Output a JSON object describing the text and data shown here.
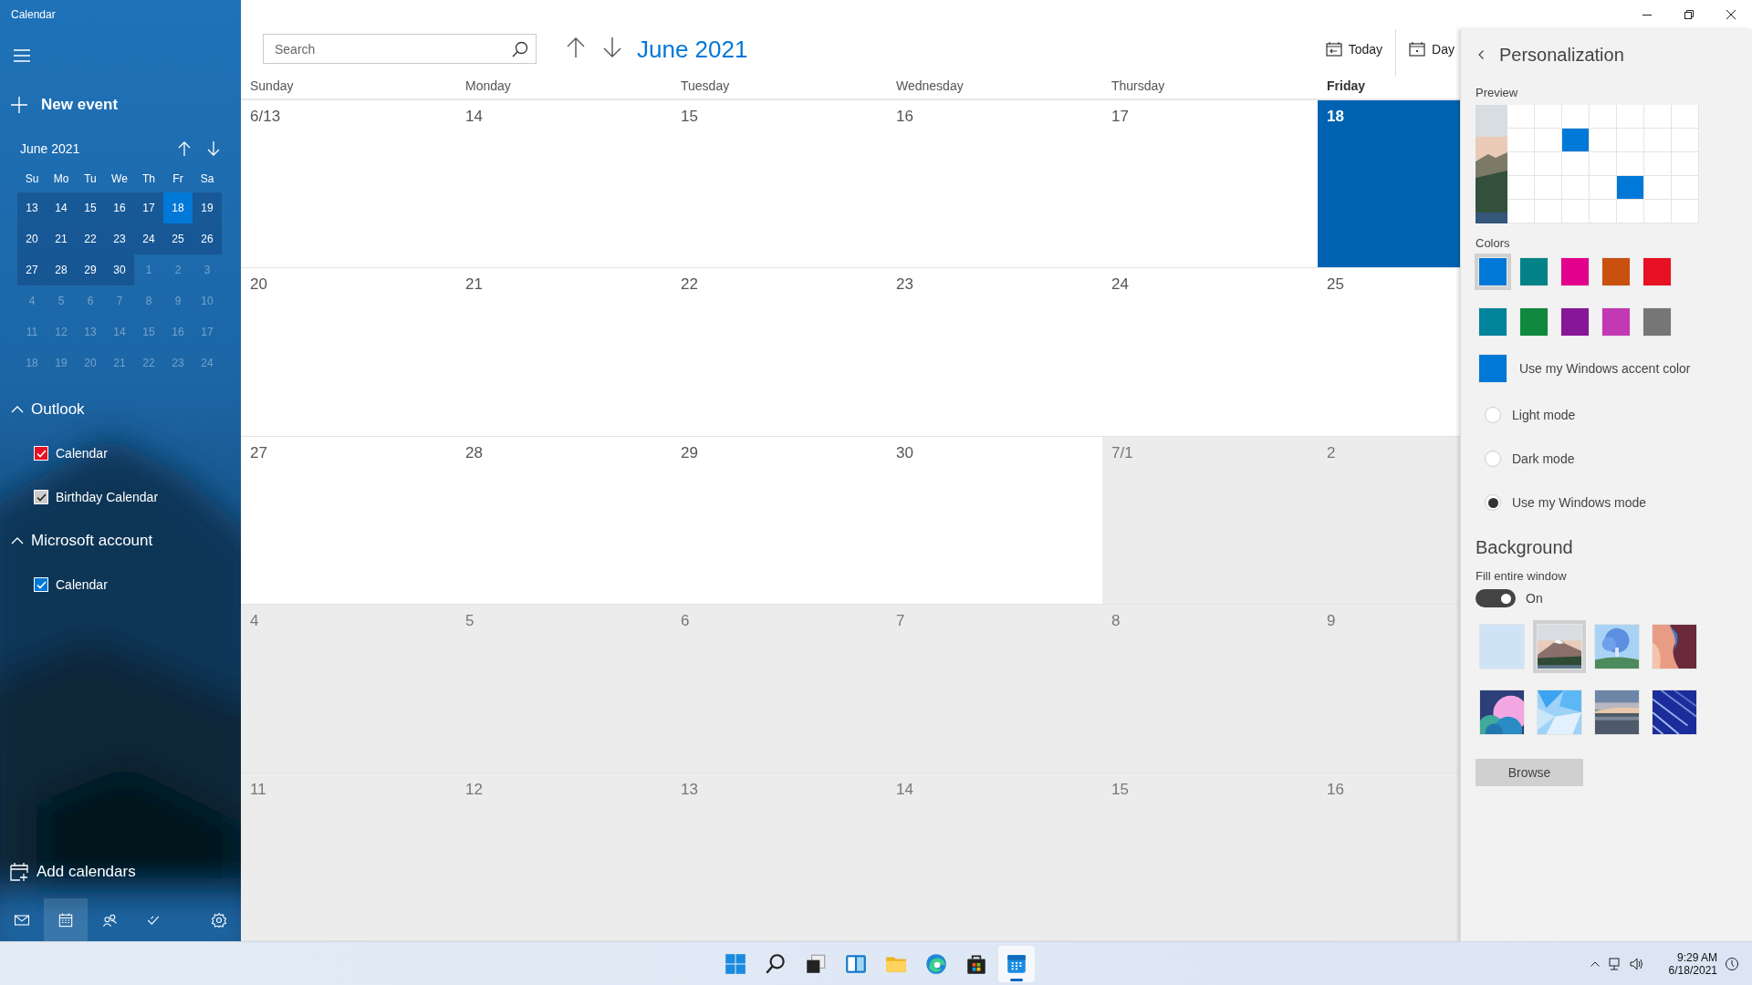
{
  "app_title": "Calendar",
  "sidebar": {
    "new_event": "New event",
    "mini_calendar": {
      "title": "June 2021",
      "weekdays": [
        "Su",
        "Mo",
        "Tu",
        "We",
        "Th",
        "Fr",
        "Sa"
      ],
      "weeks": [
        [
          {
            "day": "13",
            "in_view": true,
            "selected": false
          },
          {
            "day": "14",
            "in_view": true,
            "selected": false
          },
          {
            "day": "15",
            "in_view": true,
            "selected": false
          },
          {
            "day": "16",
            "in_view": true,
            "selected": false
          },
          {
            "day": "17",
            "in_view": true,
            "selected": false
          },
          {
            "day": "18",
            "in_view": true,
            "selected": true
          },
          {
            "day": "19",
            "in_view": true,
            "selected": false
          }
        ],
        [
          {
            "day": "20",
            "in_view": true,
            "selected": false
          },
          {
            "day": "21",
            "in_view": true,
            "selected": false
          },
          {
            "day": "22",
            "in_view": true,
            "selected": false
          },
          {
            "day": "23",
            "in_view": true,
            "selected": false
          },
          {
            "day": "24",
            "in_view": true,
            "selected": false
          },
          {
            "day": "25",
            "in_view": true,
            "selected": false
          },
          {
            "day": "26",
            "in_view": true,
            "selected": false
          }
        ],
        [
          {
            "day": "27",
            "in_view": true,
            "selected": false
          },
          {
            "day": "28",
            "in_view": true,
            "selected": false
          },
          {
            "day": "29",
            "in_view": true,
            "selected": false
          },
          {
            "day": "30",
            "in_view": true,
            "selected": false
          },
          {
            "day": "1",
            "in_view": false,
            "selected": false
          },
          {
            "day": "2",
            "in_view": false,
            "selected": false
          },
          {
            "day": "3",
            "in_view": false,
            "selected": false
          }
        ],
        [
          {
            "day": "4",
            "in_view": false,
            "selected": false
          },
          {
            "day": "5",
            "in_view": false,
            "selected": false
          },
          {
            "day": "6",
            "in_view": false,
            "selected": false
          },
          {
            "day": "7",
            "in_view": false,
            "selected": false
          },
          {
            "day": "8",
            "in_view": false,
            "selected": false
          },
          {
            "day": "9",
            "in_view": false,
            "selected": false
          },
          {
            "day": "10",
            "in_view": false,
            "selected": false
          }
        ],
        [
          {
            "day": "11",
            "in_view": false,
            "selected": false
          },
          {
            "day": "12",
            "in_view": false,
            "selected": false
          },
          {
            "day": "13",
            "in_view": false,
            "selected": false
          },
          {
            "day": "14",
            "in_view": false,
            "selected": false
          },
          {
            "day": "15",
            "in_view": false,
            "selected": false
          },
          {
            "day": "16",
            "in_view": false,
            "selected": false
          },
          {
            "day": "17",
            "in_view": false,
            "selected": false
          }
        ],
        [
          {
            "day": "18",
            "in_view": false,
            "selected": false
          },
          {
            "day": "19",
            "in_view": false,
            "selected": false
          },
          {
            "day": "20",
            "in_view": false,
            "selected": false
          },
          {
            "day": "21",
            "in_view": false,
            "selected": false
          },
          {
            "day": "22",
            "in_view": false,
            "selected": false
          },
          {
            "day": "23",
            "in_view": false,
            "selected": false
          },
          {
            "day": "24",
            "in_view": false,
            "selected": false
          }
        ]
      ]
    },
    "accounts": [
      {
        "name": "Outlook",
        "expanded": true,
        "calendars": [
          {
            "name": "Calendar",
            "checked": true,
            "color": "#e81123"
          },
          {
            "name": "Birthday Calendar",
            "checked": true,
            "color": "#cccccc"
          }
        ]
      },
      {
        "name": "Microsoft account",
        "expanded": true,
        "calendars": [
          {
            "name": "Calendar",
            "checked": true,
            "color": "#0078d7"
          }
        ]
      }
    ],
    "add_calendars": "Add calendars",
    "nav": [
      {
        "kind": "mail",
        "selected": false
      },
      {
        "kind": "calendar",
        "selected": true
      },
      {
        "kind": "people",
        "selected": false
      },
      {
        "kind": "todo",
        "selected": false
      },
      {
        "kind": "settings",
        "selected": false
      }
    ]
  },
  "main": {
    "search": {
      "placeholder": "Search"
    },
    "title": "June 2021",
    "view_buttons": [
      {
        "kind": "today",
        "label": "Today"
      },
      {
        "kind": "day",
        "label": "Day"
      }
    ],
    "weekdays": [
      {
        "label": "Sunday",
        "selected": false
      },
      {
        "label": "Monday",
        "selected": false
      },
      {
        "label": "Tuesday",
        "selected": false
      },
      {
        "label": "Wednesday",
        "selected": false
      },
      {
        "label": "Thursday",
        "selected": false
      },
      {
        "label": "Friday",
        "selected": true
      }
    ],
    "weeks": [
      [
        {
          "label": "6/13",
          "other_month": false,
          "selected": false
        },
        {
          "label": "14",
          "other_month": false,
          "selected": false
        },
        {
          "label": "15",
          "other_month": false,
          "selected": false
        },
        {
          "label": "16",
          "other_month": false,
          "selected": false
        },
        {
          "label": "17",
          "other_month": false,
          "selected": false
        },
        {
          "label": "18",
          "other_month": false,
          "selected": true
        }
      ],
      [
        {
          "label": "20",
          "other_month": false,
          "selected": false
        },
        {
          "label": "21",
          "other_month": false,
          "selected": false
        },
        {
          "label": "22",
          "other_month": false,
          "selected": false
        },
        {
          "label": "23",
          "other_month": false,
          "selected": false
        },
        {
          "label": "24",
          "other_month": false,
          "selected": false
        },
        {
          "label": "25",
          "other_month": false,
          "selected": false
        }
      ],
      [
        {
          "label": "27",
          "other_month": false,
          "selected": false
        },
        {
          "label": "28",
          "other_month": false,
          "selected": false
        },
        {
          "label": "29",
          "other_month": false,
          "selected": false
        },
        {
          "label": "30",
          "other_month": false,
          "selected": false
        },
        {
          "label": "7/1",
          "other_month": true,
          "selected": false
        },
        {
          "label": "2",
          "other_month": true,
          "selected": false
        }
      ],
      [
        {
          "label": "4",
          "other_month": true,
          "selected": false
        },
        {
          "label": "5",
          "other_month": true,
          "selected": false
        },
        {
          "label": "6",
          "other_month": true,
          "selected": false
        },
        {
          "label": "7",
          "other_month": true,
          "selected": false
        },
        {
          "label": "8",
          "other_month": true,
          "selected": false
        },
        {
          "label": "9",
          "other_month": true,
          "selected": false
        }
      ],
      [
        {
          "label": "11",
          "other_month": true,
          "selected": false
        },
        {
          "label": "12",
          "other_month": true,
          "selected": false
        },
        {
          "label": "13",
          "other_month": true,
          "selected": false
        },
        {
          "label": "14",
          "other_month": true,
          "selected": false
        },
        {
          "label": "15",
          "other_month": true,
          "selected": false
        },
        {
          "label": "16",
          "other_month": true,
          "selected": false
        }
      ]
    ]
  },
  "panel": {
    "title": "Personalization",
    "preview": {
      "label": "Preview",
      "rows": [
        [
          {
            "filled": false
          },
          {
            "filled": false
          },
          {
            "filled": false
          },
          {
            "filled": false
          },
          {
            "filled": false
          },
          {
            "filled": false
          },
          {
            "filled": false
          }
        ],
        [
          {
            "filled": false
          },
          {
            "filled": false
          },
          {
            "filled": true
          },
          {
            "filled": false
          },
          {
            "filled": false
          },
          {
            "filled": false
          },
          {
            "filled": false
          }
        ],
        [
          {
            "filled": false
          },
          {
            "filled": false
          },
          {
            "filled": false
          },
          {
            "filled": false
          },
          {
            "filled": false
          },
          {
            "filled": false
          },
          {
            "filled": false
          }
        ],
        [
          {
            "filled": false
          },
          {
            "filled": false
          },
          {
            "filled": false
          },
          {
            "filled": false
          },
          {
            "filled": true
          },
          {
            "filled": false
          },
          {
            "filled": false
          }
        ],
        [
          {
            "filled": false
          },
          {
            "filled": false
          },
          {
            "filled": false
          },
          {
            "filled": false
          },
          {
            "filled": false
          },
          {
            "filled": false
          },
          {
            "filled": false
          }
        ]
      ]
    },
    "colors_label": "Colors",
    "swatches": [
      {
        "color": "#0078d7",
        "selected": true
      },
      {
        "color": "#038387",
        "selected": false
      },
      {
        "color": "#e3008c",
        "selected": false
      },
      {
        "color": "#ca5010",
        "selected": false
      },
      {
        "color": "#e81123",
        "selected": false
      },
      {
        "color": "#00849b",
        "selected": false
      },
      {
        "color": "#10893e",
        "selected": false
      },
      {
        "color": "#881798",
        "selected": false
      },
      {
        "color": "#c239b3",
        "selected": false
      },
      {
        "color": "#767676",
        "selected": false
      }
    ],
    "accent": {
      "color": "#0078d7",
      "label": "Use my Windows accent color"
    },
    "modes": [
      {
        "label": "Light mode",
        "selected": false
      },
      {
        "label": "Dark mode",
        "selected": false
      },
      {
        "label": "Use my Windows mode",
        "selected": true
      }
    ],
    "background_heading": "Background",
    "fill_label": "Fill entire window",
    "fill_toggle": {
      "on": true,
      "label": "On"
    },
    "backgrounds": [
      {
        "kind": "plain",
        "selected": false
      },
      {
        "kind": "mountain",
        "selected": true
      },
      {
        "kind": "tree",
        "selected": false
      },
      {
        "kind": "canyon",
        "selected": false
      },
      {
        "kind": "bubbles",
        "selected": false
      },
      {
        "kind": "polygons",
        "selected": false
      },
      {
        "kind": "lake",
        "selected": false
      },
      {
        "kind": "streaks",
        "selected": false
      }
    ],
    "browse": "Browse"
  },
  "taskbar": {
    "apps": [
      {
        "kind": "start",
        "active": false
      },
      {
        "kind": "search",
        "active": false
      },
      {
        "kind": "taskview",
        "active": false
      },
      {
        "kind": "widgets",
        "active": false
      },
      {
        "kind": "explorer",
        "active": false
      },
      {
        "kind": "edge",
        "active": false
      },
      {
        "kind": "store",
        "active": false
      },
      {
        "kind": "calendar",
        "active": true
      }
    ],
    "time": "9:29 AM",
    "date": "6/18/2021"
  }
}
